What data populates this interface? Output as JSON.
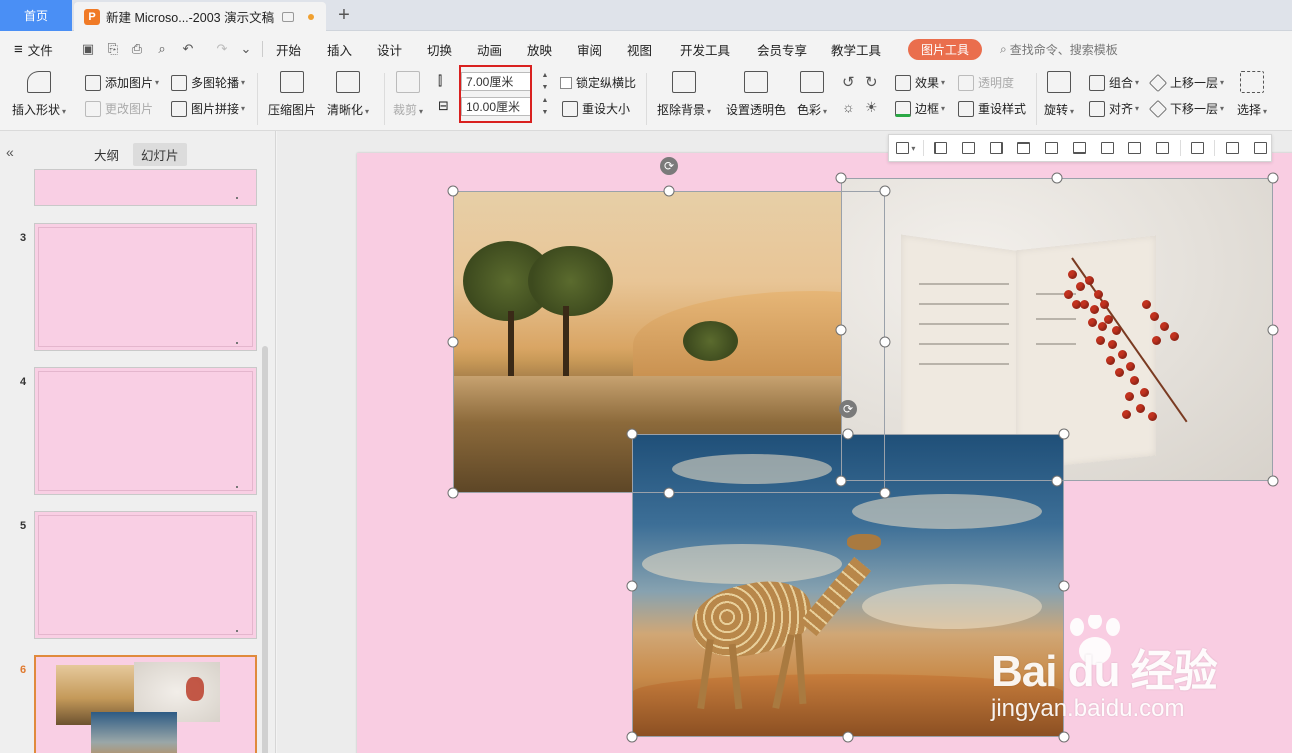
{
  "tabs": {
    "home": "首页",
    "doc_logo": "P",
    "doc_title": "新建 Microso...-2003 演示文稿",
    "new_tab": "+"
  },
  "menu": {
    "file": "文件",
    "items": [
      "开始",
      "插入",
      "设计",
      "切换",
      "动画",
      "放映",
      "审阅",
      "视图",
      "开发工具",
      "会员专享",
      "教学工具"
    ],
    "picture_tools": "图片工具",
    "search": "查找命令、搜索模板"
  },
  "ribbon": {
    "insert_shape": "插入形状",
    "add_picture": "添加图片",
    "change_picture": "更改图片",
    "multi_carousel": "多图轮播",
    "picture_collage": "图片拼接",
    "compress": "压缩图片",
    "sharpen": "清晰化",
    "crop": "裁剪",
    "height_value": "7.00厘米",
    "width_value": "10.00厘米",
    "lock_ratio": "锁定纵横比",
    "reset_size": "重设大小",
    "remove_bg": "抠除背景",
    "set_transparent": "设置透明色",
    "color": "色彩",
    "effects": "效果",
    "transparency": "透明度",
    "border": "边框",
    "reset_style": "重设样式",
    "rotate": "旋转",
    "group": "组合",
    "align": "对齐",
    "bring_forward": "上移一层",
    "send_backward": "下移一层",
    "select": "选择"
  },
  "left_pane": {
    "collapse": "«",
    "tab_outline": "大纲",
    "tab_slides": "幻灯片",
    "slide_numbers": [
      "3",
      "4",
      "5",
      "6"
    ]
  },
  "watermark": {
    "main": "Bai du 经验",
    "sub": "jingyan.baidu.com"
  },
  "colors": {
    "accent": "#4a8ff5",
    "picture_tools_badge": "#ea6e4d",
    "slide_background": "#f9cde2",
    "highlight_box": "#d9201f"
  }
}
